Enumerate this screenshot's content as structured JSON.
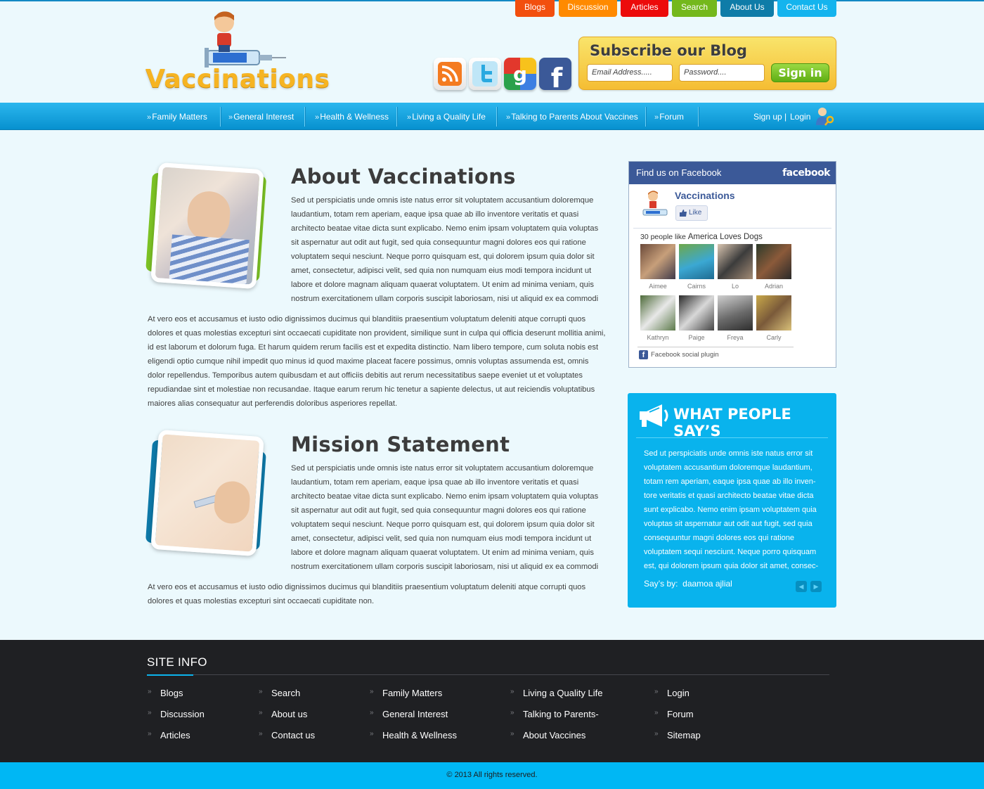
{
  "top_tabs": [
    {
      "label": "Blogs",
      "color": "#f24f0e"
    },
    {
      "label": "Discussion",
      "color": "#ff8a00"
    },
    {
      "label": "Articles",
      "color": "#ec0b0b"
    },
    {
      "label": "Search",
      "color": "#74b81c"
    },
    {
      "label": "About Us",
      "color": "#0e7ca8"
    },
    {
      "label": "Contact Us",
      "color": "#14b4ee"
    }
  ],
  "logo": {
    "text": "Vaccinations"
  },
  "subscribe": {
    "title": "Subscribe our Blog",
    "email_placeholder": "Email Address.....",
    "password_placeholder": "Password....",
    "signin_label": "Sign in"
  },
  "main_nav": {
    "items": [
      "Family Matters",
      "General Interest",
      "Health & Wellness",
      "Living a Quality Life",
      "Talking to Parents About Vaccines",
      "Forum"
    ],
    "signup": "Sign up",
    "separator": "|",
    "login": "Login"
  },
  "about": {
    "title": "About Vaccinations",
    "body1": "Sed ut perspiciatis unde omnis iste natus error sit voluptatem accusantium doloremque laudantium, totam rem aperiam, eaque ipsa quae ab illo inventore veritatis et quasi architecto beatae vitae dicta sunt explicabo. Nemo enim ipsam voluptatem quia voluptas sit aspernatur aut odit aut fugit, sed quia consequuntur magni dolores eos qui ratione voluptatem sequi nesciunt. Neque porro quisquam est, qui dolorem ipsum quia dolor sit amet, consectetur, adipisci velit, sed quia non numquam eius modi tempora incidunt ut labore et dolore magnam aliquam quaerat voluptatem. Ut enim ad minima veniam, quis nostrum exercitationem ullam corporis suscipit laboriosam, nisi ut aliquid ex ea commodi",
    "body2": "At vero eos et accusamus et iusto odio dignissimos ducimus qui blanditiis praesentium voluptatum deleniti atque corrupti quos dolores et quas molestias excepturi sint occaecati cupiditate non provident, similique sunt in culpa qui officia deserunt mollitia animi, id est laborum et dolorum fuga. Et harum quidem rerum facilis est et expedita distinctio. Nam libero tempore, cum soluta nobis est eligendi optio cumque nihil impedit quo minus id quod maxime placeat facere possimus, omnis voluptas assumenda est, omnis dolor repellendus. Temporibus autem quibusdam et aut officiis debitis aut rerum necessitatibus saepe eveniet ut et voluptates repudiandae sint et molestiae non recusandae. Itaque earum rerum hic tenetur a sapiente delectus, ut aut reiciendis voluptatibus maiores alias consequatur aut perferendis doloribus asperiores repellat."
  },
  "mission": {
    "title": "Mission Statement",
    "body1": "Sed ut perspiciatis unde omnis iste natus error sit voluptatem accusantium doloremque laudantium, totam rem aperiam, eaque ipsa quae ab illo inventore veritatis et quasi architecto beatae vitae dicta sunt explicabo. Nemo enim ipsam voluptatem quia voluptas sit aspernatur aut odit aut fugit, sed quia consequuntur magni dolores eos qui ratione voluptatem sequi nesciunt. Neque porro quisquam est, qui dolorem ipsum quia dolor sit amet, consectetur, adipisci velit, sed quia non numquam eius modi tempora incidunt ut labore et dolore magnam aliquam quaerat voluptatem. Ut enim ad minima veniam, quis nostrum exercitationem ullam corporis suscipit laboriosam, nisi ut aliquid ex ea commodi",
    "body2": "At vero eos et accusamus et iusto odio dignissimos ducimus qui blanditiis praesentium voluptatum deleniti atque corrupti quos dolores et quas molestias excepturi sint occaecati cupiditate non."
  },
  "facebook": {
    "header": "Find us on Facebook",
    "brand": "facebook",
    "page_name": "Vaccinations",
    "like_label": "Like",
    "likes_text": "30 people like",
    "likes_page": "America Loves Dogs",
    "fans": [
      "Aimee",
      "Cairns",
      "Lo",
      "Adrian",
      "Kathryn",
      "Paige",
      "Freya",
      "Carly"
    ],
    "plugin_label": "Facebook social plugin"
  },
  "testimonials": {
    "title": "WHAT PEOPLE SAY’S",
    "text": "Sed ut perspiciatis unde omnis iste natus error sit voluptatem accusantium doloremque laudantium, totam rem aperiam, eaque ipsa quae ab illo inven-tore veritatis et quasi architecto beatae vitae dicta sunt explicabo. Nemo enim ipsam voluptatem quia voluptas sit aspernatur aut odit aut fugit, sed quia consequuntur magni dolores eos qui ratione voluptatem sequi nesciunt. Neque porro quisquam est, qui dolorem ipsum quia dolor sit amet, consec-",
    "by_label": "Say’s by:",
    "by_name": "daamoa ajlial"
  },
  "footer": {
    "title": "SITE INFO",
    "columns": [
      [
        "Blogs",
        "Discussion",
        "Articles"
      ],
      [
        "Search",
        "About us",
        "Contact us"
      ],
      [
        "Family Matters",
        "General Interest",
        "Health & Wellness"
      ],
      [
        "Living a Quality Life",
        "Talking to Parents-",
        "About Vaccines"
      ],
      [
        "Login",
        "Forum",
        "Sitemap"
      ]
    ],
    "copyright": "© 2013 All rights reserved."
  }
}
